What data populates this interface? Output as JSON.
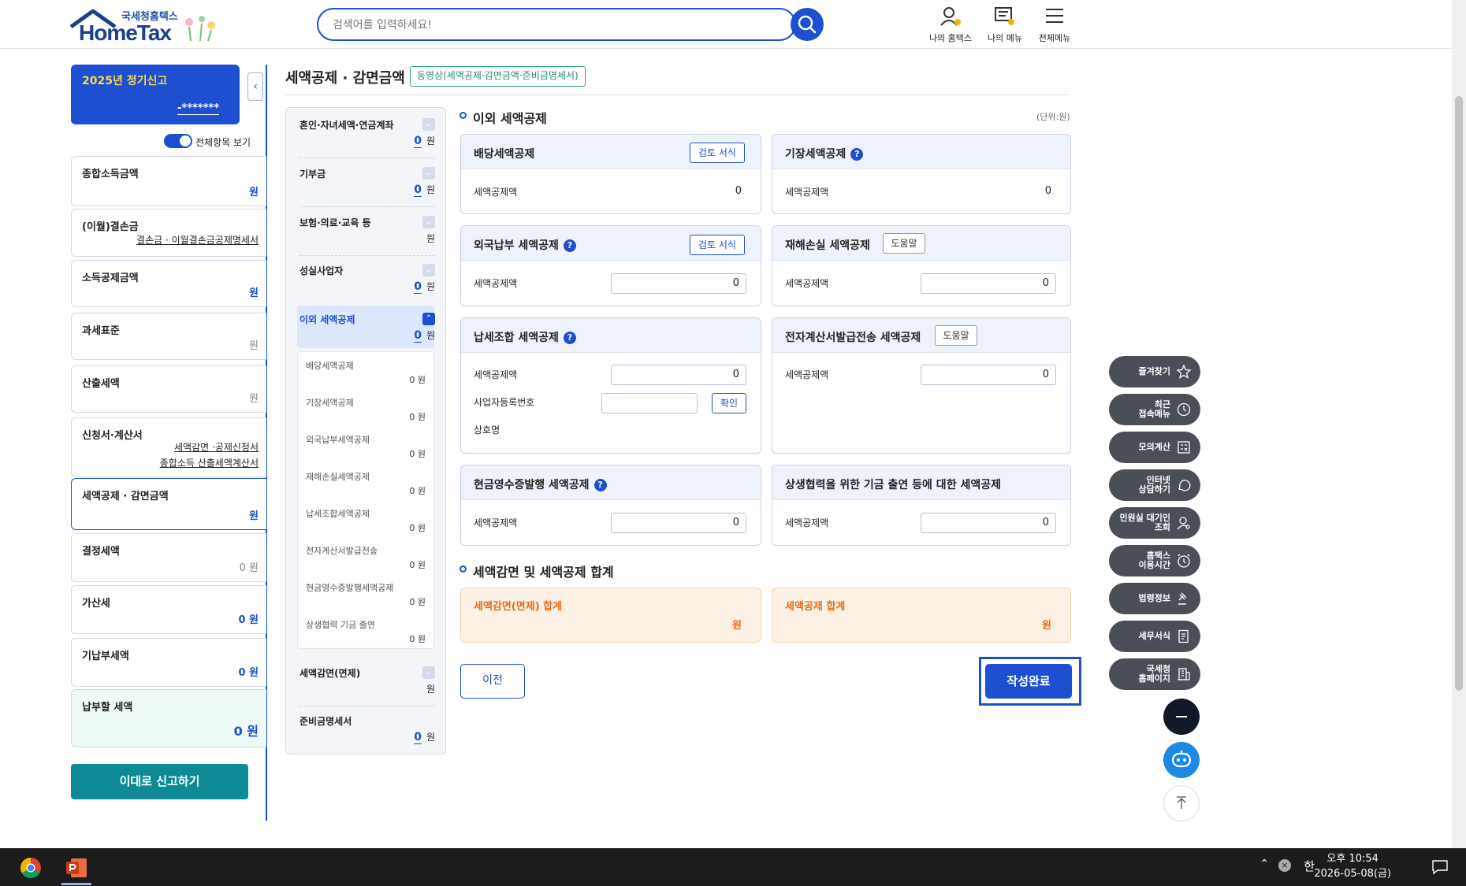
{
  "header": {
    "logo_sub": "국세청홈택스",
    "logo_main": "HomeTax",
    "search_placeholder": "검색어를 입력하세요!",
    "nav": [
      {
        "label": "나의 홈택스",
        "icon": "user-icon"
      },
      {
        "label": "나의 메뉴",
        "icon": "my-menu-icon"
      },
      {
        "label": "전체메뉴",
        "icon": "hamburger-icon"
      }
    ]
  },
  "left": {
    "filing_title": "2025년 정기신고",
    "masked_id": "-*******",
    "toggle_label": "전체항목 보기",
    "cards": [
      {
        "title": "종합소득금액",
        "value": "원"
      },
      {
        "title": "(이월)결손금",
        "link": "결손금 · 이월결손금공제명세서"
      },
      {
        "title": "소득공제금액",
        "value": "원"
      },
      {
        "title": "과세표준",
        "value": "원"
      },
      {
        "title": "산출세액",
        "value": "원"
      },
      {
        "title": "신청서·계산서",
        "link1": "세액감면 ·공제신청서",
        "link2": "종합소득 산출세액계산서"
      },
      {
        "title": "세액공제 · 감면금액",
        "value": "원"
      },
      {
        "title": "결정세액",
        "value": "0 원"
      },
      {
        "title": "가산세",
        "value": "0 원"
      },
      {
        "title": "기납부세액",
        "value": "0 원"
      },
      {
        "title": "납부할 세액",
        "value": "0 원"
      }
    ],
    "report_button": "이대로 신고하기"
  },
  "main": {
    "page_title": "세액공제 · 감면금액",
    "video_badge": "동영상(세액공제·감면금액·준비금명세서)",
    "nav": [
      {
        "label": "혼인·자녀세액·연금계좌",
        "value": "0",
        "unit": "원"
      },
      {
        "label": "기부금",
        "value": "0",
        "unit": "원"
      },
      {
        "label": "보험·의료·교육 등",
        "value": "",
        "unit": "원"
      },
      {
        "label": "성실사업자",
        "value": "0",
        "unit": "원"
      },
      {
        "label": "이외 세액공제",
        "value": "0",
        "unit": "원"
      },
      {
        "label": "세액감면(면제)",
        "value": "",
        "unit": "원"
      },
      {
        "label": "준비금명세서",
        "value": "0",
        "unit": "원"
      }
    ],
    "sub_nav": [
      {
        "label": "배당세액공제",
        "value": "0 원"
      },
      {
        "label": "기장세액공제",
        "value": "0 원"
      },
      {
        "label": "외국납부세액공제",
        "value": "0 원"
      },
      {
        "label": "재해손실세액공제",
        "value": "0 원"
      },
      {
        "label": "납세조합세액공제",
        "value": "0 원"
      },
      {
        "label": "전자계산서발급전송",
        "value": "0 원"
      },
      {
        "label": "현금영수증발행세액공제",
        "value": "0 원"
      },
      {
        "label": "상생협력 기금 출연",
        "value": "0 원"
      }
    ],
    "section1_title": "이외 세액공제",
    "unit_note": "(단위:원)",
    "cards": {
      "dividend": {
        "title": "배당세액공제",
        "button": "검토 서식",
        "label": "세액공제액",
        "value": "0"
      },
      "bookkeeping": {
        "title": "기장세액공제",
        "label": "세액공제액",
        "value": "0"
      },
      "foreign": {
        "title": "외국납부 세액공제",
        "button": "검토 서식",
        "label": "세액공제액",
        "value": "0"
      },
      "disaster": {
        "title": "재해손실 세액공제",
        "button": "도움말",
        "label": "세액공제액",
        "value": "0"
      },
      "union": {
        "title": "납세조합 세액공제",
        "label": "세액공제액",
        "value": "0",
        "label2": "사업자등록번호",
        "confirm": "확인",
        "label3": "상호명"
      },
      "einvoice": {
        "title": "전자계산서발급전송 세액공제",
        "button": "도움말",
        "label": "세액공제액",
        "value": "0"
      },
      "cash": {
        "title": "현금영수증발행 세액공제",
        "label": "세액공제액",
        "value": "0"
      },
      "coop": {
        "title": "상생협력을 위한 기금 출연 등에 대한 세액공제",
        "label": "세액공제액",
        "value": "0"
      }
    },
    "section2_title": "세액감면 및 세액공제 합계",
    "sum1": {
      "title": "세액감면(면제) 합계",
      "value": "원"
    },
    "sum2": {
      "title": "세액공제 합계",
      "value": "원"
    },
    "prev_button": "이전",
    "done_button": "작성완료"
  },
  "float_menu": [
    {
      "label": "즐겨찾기",
      "icon": "star-icon"
    },
    {
      "label": "최근\n접속메뉴",
      "icon": "clock-icon"
    },
    {
      "label": "모의계산",
      "icon": "calculator-icon"
    },
    {
      "label": "인터넷\n상담하기",
      "icon": "chat-icon"
    },
    {
      "label": "민원실 대기인\n조회",
      "icon": "person-search-icon"
    },
    {
      "label": "홈택스\n이용시간",
      "icon": "alarm-icon"
    },
    {
      "label": "법령정보",
      "icon": "gavel-icon"
    },
    {
      "label": "세무서식",
      "icon": "form-icon"
    },
    {
      "label": "국세청\n홈페이지",
      "icon": "building-icon"
    }
  ],
  "taskbar": {
    "time": "오후 10:54",
    "date": "2026-05-08(금)",
    "ime": "한"
  }
}
